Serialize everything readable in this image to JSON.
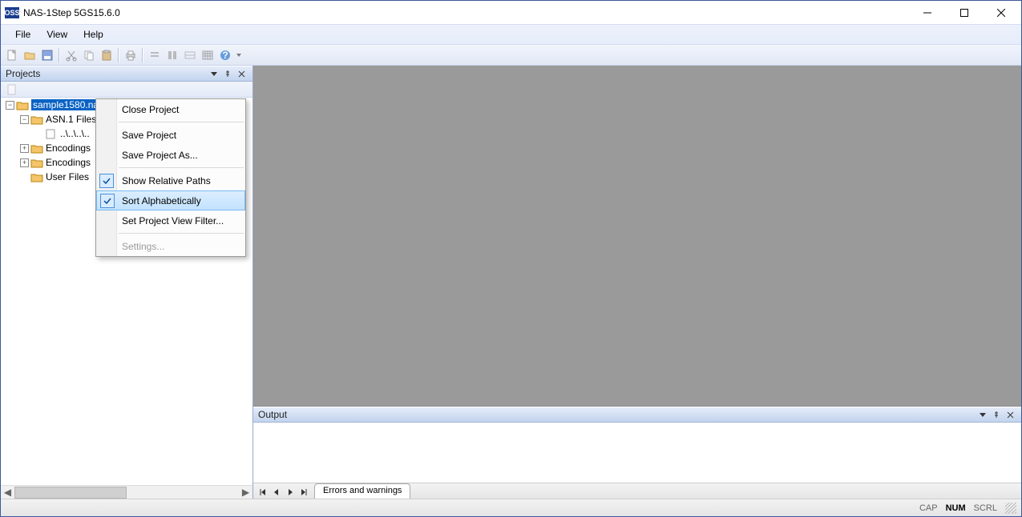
{
  "window": {
    "logo": "OSS",
    "title": "NAS-1Step 5GS15.6.0"
  },
  "menu": {
    "file": "File",
    "view": "View",
    "help": "Help"
  },
  "panes": {
    "projects": "Projects",
    "output": "Output"
  },
  "tree": {
    "root": "sample1580.nasproj [P][A]",
    "items": [
      {
        "label": "ASN.1 Files",
        "open": true
      },
      {
        "label": "..\\..\\..\\..",
        "leaf": true
      },
      {
        "label": "Encodings"
      },
      {
        "label": "Encodings"
      },
      {
        "label": "User Files"
      }
    ]
  },
  "context_menu": {
    "close": "Close Project",
    "save": "Save Project",
    "saveas": "Save Project As...",
    "relpaths": "Show Relative Paths",
    "sortaz": "Sort Alphabetically",
    "filter": "Set Project View Filter...",
    "settings": "Settings..."
  },
  "output_tab": "Errors and warnings",
  "status": {
    "cap": "CAP",
    "num": "NUM",
    "scrl": "SCRL"
  }
}
